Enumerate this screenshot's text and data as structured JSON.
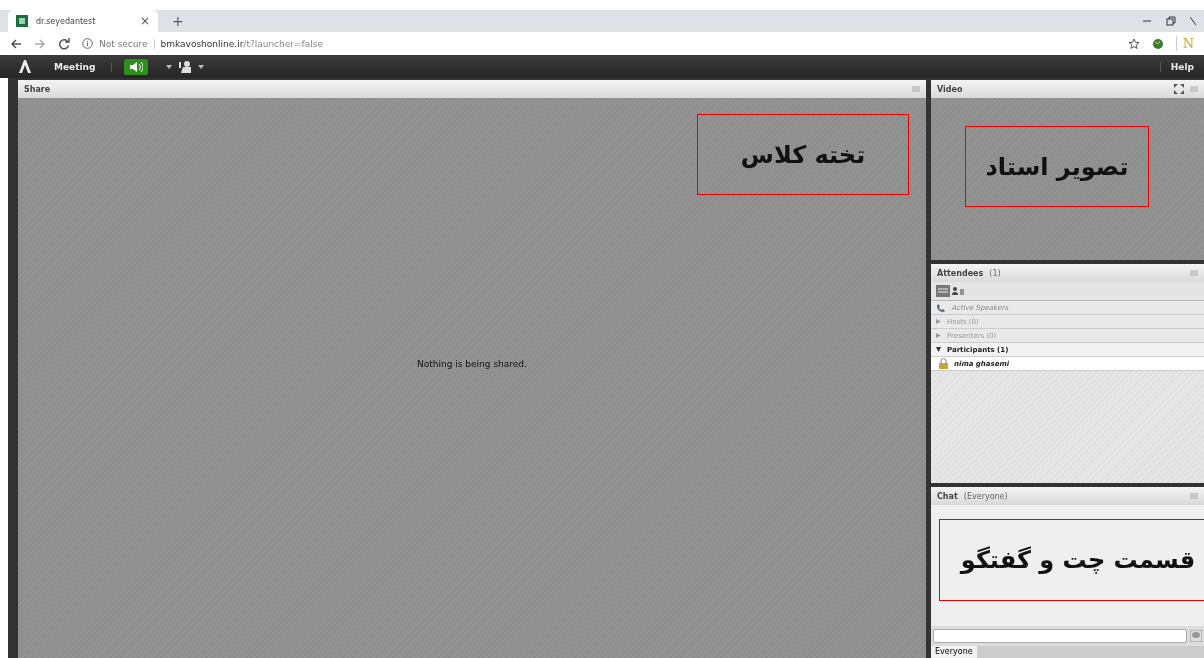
{
  "browser": {
    "tab_title": "dr.seyedantest",
    "new_tab": "+",
    "close_tab": "×",
    "security": "Not secure",
    "url_host": "bmkavoshonline.ir",
    "url_path": "/t?launcher=false",
    "extension": "N"
  },
  "meeting_bar": {
    "menu": "Meeting",
    "help": "Help",
    "audio_on": true
  },
  "share": {
    "title": "Share",
    "message": "Nothing is being shared.",
    "annotation": "تخته کلاس"
  },
  "video": {
    "title": "Video",
    "annotation": "تصویر استاد"
  },
  "attendees": {
    "title": "Attendees",
    "count": "(1)",
    "active_speakers": "Active Speakers",
    "groups": [
      {
        "label": "Hosts (0)",
        "expanded": false
      },
      {
        "label": "Presenters (0)",
        "expanded": false
      },
      {
        "label": "Participants (1)",
        "expanded": true,
        "children": [
          {
            "name": "nima ghasemi"
          }
        ]
      }
    ]
  },
  "chat": {
    "title": "Chat",
    "scope": "(Everyone)",
    "annotation": "قسمت چت و گفتگو",
    "tab": "Everyone"
  }
}
